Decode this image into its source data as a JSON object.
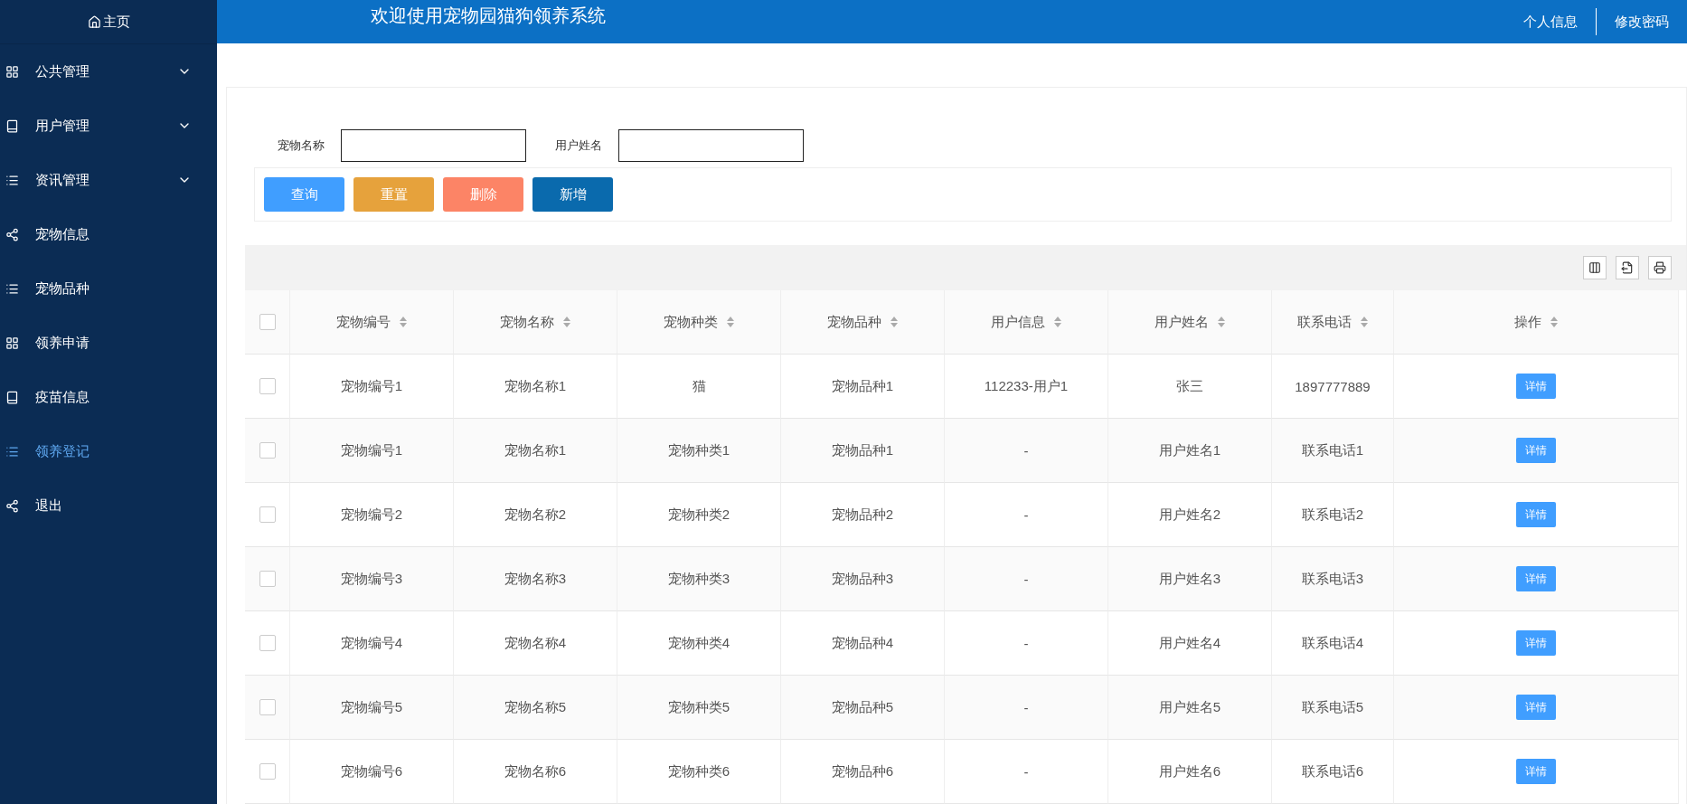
{
  "sidebar": {
    "home": "主页",
    "items": [
      {
        "label": "公共管理",
        "kind": "grid",
        "expandable": true,
        "selected": false
      },
      {
        "label": "用户管理",
        "kind": "book",
        "expandable": true,
        "selected": false
      },
      {
        "label": "资讯管理",
        "kind": "list",
        "expandable": true,
        "selected": false
      },
      {
        "label": "宠物信息",
        "kind": "share",
        "expandable": false,
        "selected": false
      },
      {
        "label": "宠物品种",
        "kind": "list",
        "expandable": false,
        "selected": false
      },
      {
        "label": "领养申请",
        "kind": "grid",
        "expandable": false,
        "selected": false
      },
      {
        "label": "疫苗信息",
        "kind": "book",
        "expandable": false,
        "selected": false
      },
      {
        "label": "领养登记",
        "kind": "list",
        "expandable": false,
        "selected": true
      },
      {
        "label": "退出",
        "kind": "share",
        "expandable": false,
        "selected": false
      }
    ]
  },
  "header": {
    "title": "欢迎使用宠物园猫狗领养系统",
    "links": [
      "个人信息",
      "修改密码"
    ]
  },
  "filters": [
    {
      "label": "宠物名称"
    },
    {
      "label": "用户姓名"
    }
  ],
  "buttons": [
    {
      "label": "查询",
      "kind": "query"
    },
    {
      "label": "重置",
      "kind": "reset"
    },
    {
      "label": "删除",
      "kind": "delete"
    },
    {
      "label": "新增",
      "kind": "add"
    }
  ],
  "table": {
    "all_checked": false,
    "columns": [
      "宠物编号",
      "宠物名称",
      "宠物种类",
      "宠物品种",
      "用户信息",
      "用户姓名",
      "联系电话",
      "操作"
    ],
    "rows": [
      {
        "checked": false,
        "cells": [
          "宠物编号1",
          "宠物名称1",
          "猫",
          "宠物品种1",
          "112233-用户1",
          "张三",
          "1897777889"
        ],
        "action": "详情"
      },
      {
        "checked": false,
        "cells": [
          "宠物编号1",
          "宠物名称1",
          "宠物种类1",
          "宠物品种1",
          "-",
          "用户姓名1",
          "联系电话1"
        ],
        "action": "详情"
      },
      {
        "checked": false,
        "cells": [
          "宠物编号2",
          "宠物名称2",
          "宠物种类2",
          "宠物品种2",
          "-",
          "用户姓名2",
          "联系电话2"
        ],
        "action": "详情"
      },
      {
        "checked": false,
        "cells": [
          "宠物编号3",
          "宠物名称3",
          "宠物种类3",
          "宠物品种3",
          "-",
          "用户姓名3",
          "联系电话3"
        ],
        "action": "详情"
      },
      {
        "checked": false,
        "cells": [
          "宠物编号4",
          "宠物名称4",
          "宠物种类4",
          "宠物品种4",
          "-",
          "用户姓名4",
          "联系电话4"
        ],
        "action": "详情"
      },
      {
        "checked": false,
        "cells": [
          "宠物编号5",
          "宠物名称5",
          "宠物种类5",
          "宠物品种5",
          "-",
          "用户姓名5",
          "联系电话5"
        ],
        "action": "详情"
      },
      {
        "checked": false,
        "cells": [
          "宠物编号6",
          "宠物名称6",
          "宠物种类6",
          "宠物品种6",
          "-",
          "用户姓名6",
          "联系电话6"
        ],
        "action": "详情"
      }
    ]
  }
}
